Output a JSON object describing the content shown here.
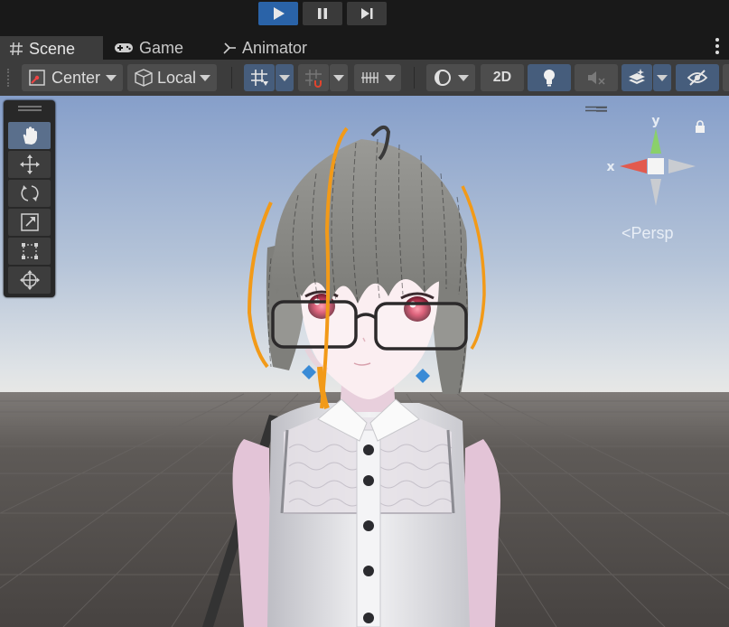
{
  "playbar": {
    "play_icon": "play-icon",
    "pause_icon": "pause-icon",
    "step_icon": "step-icon",
    "play_active": true
  },
  "tabs": [
    {
      "label": "Scene",
      "icon": "scene-grid-icon"
    },
    {
      "label": "Game",
      "icon": "gamepad-icon"
    },
    {
      "label": "Animator",
      "icon": "animator-icon"
    }
  ],
  "toolbar": {
    "pivot_mode": "Center",
    "pivot_rotation": "Local",
    "view_2d": "2D"
  },
  "gizmo": {
    "y_label": "y",
    "x_label": "x",
    "projection": "Persp"
  },
  "colors": {
    "accent": "#2a63a8",
    "toolbar": "#3c3c3c",
    "sky_top": "#8ba3cc",
    "ground": "#4b4846"
  }
}
